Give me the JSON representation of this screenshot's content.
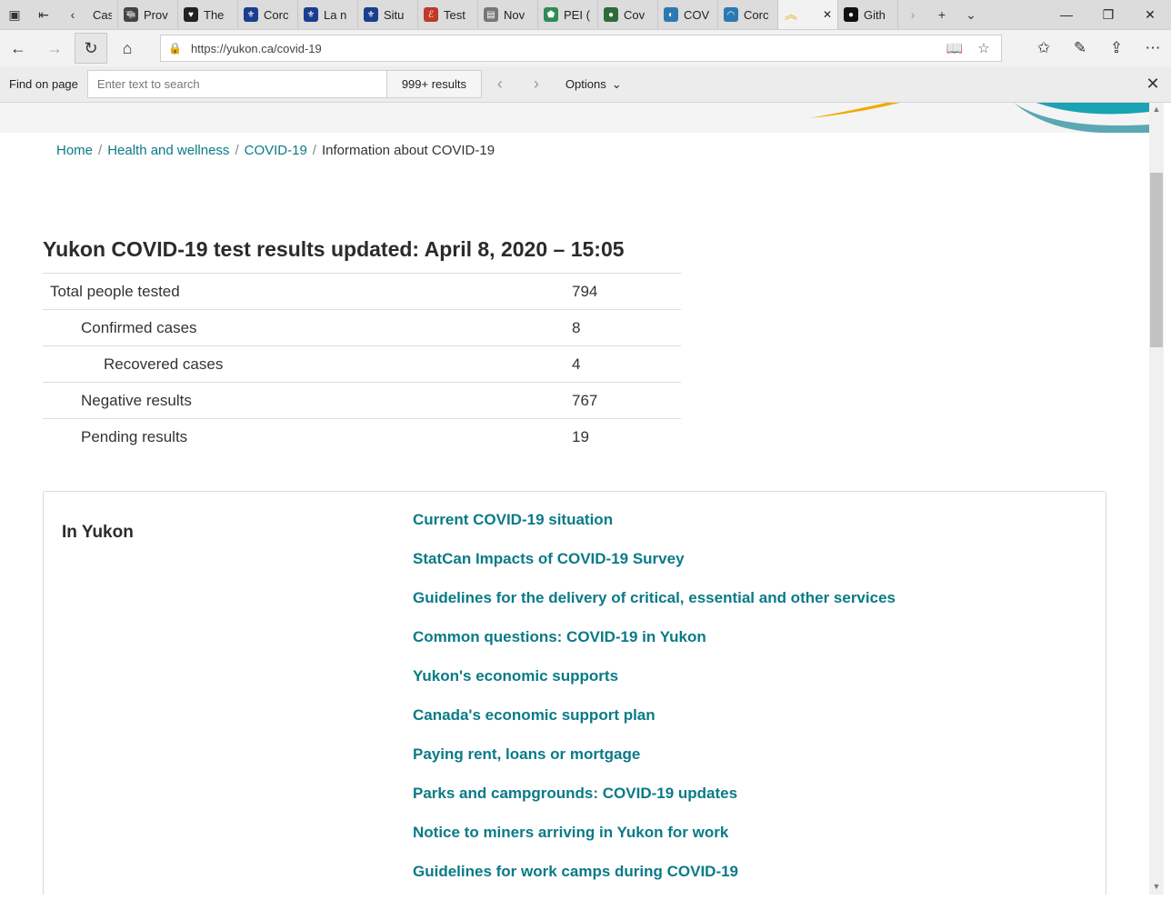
{
  "browser": {
    "tabs": [
      {
        "label": "Case",
        "fav": "#555",
        "glyph": ""
      },
      {
        "label": "Prov",
        "fav": "#444",
        "glyph": "🐃"
      },
      {
        "label": "The",
        "fav": "#222",
        "glyph": "♥"
      },
      {
        "label": "Corc",
        "fav": "#1a3d8f",
        "glyph": "⚜"
      },
      {
        "label": "La n",
        "fav": "#1a3d8f",
        "glyph": "⚜"
      },
      {
        "label": "Situ",
        "fav": "#1a3d8f",
        "glyph": "⚜"
      },
      {
        "label": "Test",
        "fav": "#c0392b",
        "glyph": "ℰ"
      },
      {
        "label": "Nov",
        "fav": "#777",
        "glyph": "▤"
      },
      {
        "label": "PEI (",
        "fav": "#2e8b57",
        "glyph": "⬟"
      },
      {
        "label": "Cov",
        "fav": "#2e6b3a",
        "glyph": "●"
      },
      {
        "label": "COV",
        "fav": "#2a7ab0",
        "glyph": "◐"
      },
      {
        "label": "Corc",
        "fav": "#2a7ab0",
        "glyph": "◠"
      },
      {
        "label": "",
        "fav": "#f5a623",
        "glyph": "︽"
      },
      {
        "label": "Gith",
        "fav": "#111",
        "glyph": "●"
      }
    ],
    "url": "https://yukon.ca/covid-19",
    "find": {
      "label": "Find on page",
      "placeholder": "Enter text to search",
      "count": "999+ results",
      "options": "Options"
    }
  },
  "breadcrumb": [
    "Home",
    "Health and wellness",
    "COVID-19",
    "Information about COVID-19"
  ],
  "results": {
    "title": "Yukon COVID-19 test results updated: April 8, 2020 – 15:05",
    "rows": [
      {
        "label": "Total people tested",
        "value": "794"
      },
      {
        "label": "Confirmed cases",
        "value": "8"
      },
      {
        "label": "Recovered cases",
        "value": "4"
      },
      {
        "label": "Negative results",
        "value": "767"
      },
      {
        "label": "Pending results",
        "value": "19"
      }
    ]
  },
  "in_yukon": {
    "heading": "In Yukon",
    "links": [
      "Current COVID-19 situation",
      "StatCan Impacts of COVID-19 Survey",
      "Guidelines for the delivery of critical, essential and other services",
      "Common questions: COVID-19 in Yukon",
      "Yukon's economic supports",
      "Canada's economic support plan",
      "Paying rent, loans or mortgage",
      "Parks and campgrounds: COVID-19 updates",
      "Notice to miners arriving in Yukon for work",
      "Guidelines for work camps during COVID-19"
    ]
  },
  "colors": {
    "link": "#0a7a87",
    "banner_teal": "#1aa3b3",
    "banner_yellow": "#f2a900"
  }
}
